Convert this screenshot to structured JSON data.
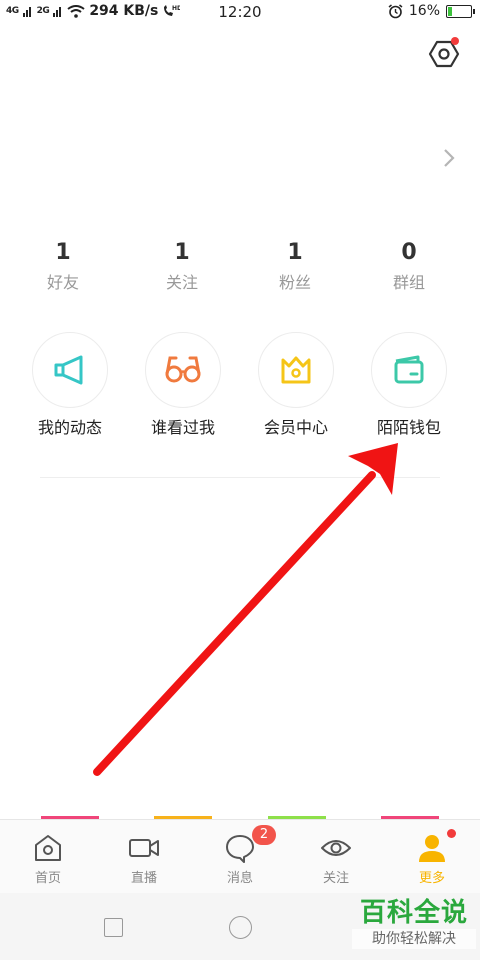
{
  "status_bar": {
    "signal_1": "4G",
    "signal_2": "2G",
    "speed": "294 KB/s",
    "time": "12:20",
    "battery_percent": "16%",
    "battery_level": 0.16
  },
  "stats": [
    {
      "value": "1",
      "label": "好友"
    },
    {
      "value": "1",
      "label": "关注"
    },
    {
      "value": "1",
      "label": "粉丝"
    },
    {
      "value": "0",
      "label": "群组"
    }
  ],
  "features": [
    {
      "label": "我的动态",
      "icon": "megaphone-icon",
      "color": "#35c6c6"
    },
    {
      "label": "谁看过我",
      "icon": "glasses-icon",
      "color": "#f07a3e"
    },
    {
      "label": "会员中心",
      "icon": "crown-icon",
      "color": "#f5c518"
    },
    {
      "label": "陌陌钱包",
      "icon": "wallet-icon",
      "color": "#3cc8a8"
    }
  ],
  "tabs": [
    {
      "label": "首页",
      "icon": "home-icon"
    },
    {
      "label": "直播",
      "icon": "video-camera-icon"
    },
    {
      "label": "消息",
      "icon": "message-bubble-icon",
      "badge": "2"
    },
    {
      "label": "关注",
      "icon": "eye-icon"
    },
    {
      "label": "更多",
      "icon": "user-icon",
      "active": true
    }
  ],
  "tab_accent_colors": [
    "#f0457a",
    "#f7b21b",
    "#8ee04a",
    "#f0457a"
  ],
  "annotation_arrow_color": "#f01414",
  "watermark": {
    "line1": "百科全说",
    "line2": "助你轻松解决"
  }
}
